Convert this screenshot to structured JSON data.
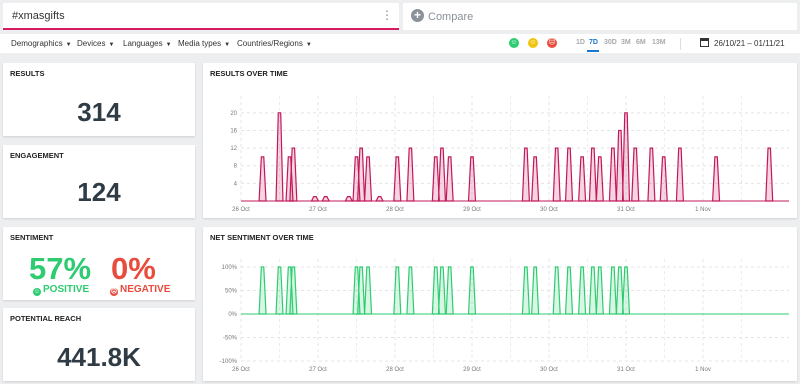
{
  "search": {
    "query": "#xmasgifts"
  },
  "compare": {
    "label": "Compare"
  },
  "filters": [
    "Demographics",
    "Devices",
    "Languages",
    "Media types",
    "Countries/Regions"
  ],
  "sentiment_filter_icons": [
    {
      "name": "positive-face-icon",
      "color": "#2ecc71",
      "glyph": "☺"
    },
    {
      "name": "neutral-face-icon",
      "color": "#f1c40f",
      "glyph": "☺"
    },
    {
      "name": "negative-face-icon",
      "color": "#e74c3c",
      "glyph": "☹"
    }
  ],
  "time_ranges": [
    "1D",
    "7D",
    "30D",
    "3M",
    "6M",
    "13M"
  ],
  "active_range": "7D",
  "date_range": "26/10/21 – 01/11/21",
  "results": {
    "title": "RESULTS",
    "value": "314"
  },
  "engagement": {
    "title": "ENGAGEMENT",
    "value": "124"
  },
  "sentiment": {
    "title": "SENTIMENT",
    "positive_pct": "57%",
    "positive_label": "POSITIVE",
    "negative_pct": "0%",
    "negative_label": "NEGATIVE",
    "positive_color": "#2ecc71",
    "negative_color": "#e74c3c"
  },
  "reach": {
    "title": "POTENTIAL REACH",
    "value": "441.8K"
  },
  "results_over_time": {
    "title": "RESULTS OVER TIME"
  },
  "net_sentiment": {
    "title": "NET SENTIMENT OVER TIME"
  },
  "chart_data": [
    {
      "type": "area",
      "title": "RESULTS OVER TIME",
      "color": "#c2185b",
      "x_ticks": [
        "26 Oct",
        "27 Oct",
        "28 Oct",
        "29 Oct",
        "30 Oct",
        "31 Oct",
        "1 Nov"
      ],
      "y_ticks": [
        4,
        8,
        12,
        16,
        20
      ],
      "ylim": [
        0,
        22
      ],
      "grid": true,
      "x_unit": "day offset from 26 Oct",
      "series": [
        {
          "values": [
            [
              0.28,
              10
            ],
            [
              0.5,
              20
            ],
            [
              0.63,
              10
            ],
            [
              0.68,
              12
            ],
            [
              0.96,
              1
            ],
            [
              1.1,
              1
            ],
            [
              1.4,
              1
            ],
            [
              1.5,
              10
            ],
            [
              1.56,
              12
            ],
            [
              1.65,
              10
            ],
            [
              1.8,
              1
            ],
            [
              2.03,
              10
            ],
            [
              2.2,
              12
            ],
            [
              2.53,
              10
            ],
            [
              2.61,
              12
            ],
            [
              2.71,
              10
            ],
            [
              3.0,
              10
            ],
            [
              3.7,
              12
            ],
            [
              3.82,
              10
            ],
            [
              4.1,
              12
            ],
            [
              4.26,
              12
            ],
            [
              4.43,
              10
            ],
            [
              4.57,
              12
            ],
            [
              4.66,
              10
            ],
            [
              4.83,
              12
            ],
            [
              4.92,
              16
            ],
            [
              5.0,
              20
            ],
            [
              5.12,
              12
            ],
            [
              5.33,
              12
            ],
            [
              5.49,
              10
            ],
            [
              5.7,
              12
            ],
            [
              6.17,
              10
            ],
            [
              6.86,
              12
            ]
          ]
        }
      ]
    },
    {
      "type": "area",
      "title": "NET SENTIMENT OVER TIME",
      "color": "#2ecc71",
      "x_ticks": [
        "26 Oct",
        "27 Oct",
        "28 Oct",
        "29 Oct",
        "30 Oct",
        "31 Oct",
        "1 Nov"
      ],
      "y_ticks": [
        "100%",
        "50%",
        "0%",
        "-50%",
        "-100%"
      ],
      "ylim": [
        -100,
        100
      ],
      "grid": true,
      "x_unit": "day offset from 26 Oct",
      "series": [
        {
          "values": [
            [
              0.28,
              100
            ],
            [
              0.5,
              100
            ],
            [
              0.63,
              100
            ],
            [
              0.68,
              100
            ],
            [
              1.5,
              100
            ],
            [
              1.56,
              100
            ],
            [
              1.65,
              100
            ],
            [
              2.03,
              100
            ],
            [
              2.2,
              100
            ],
            [
              2.53,
              100
            ],
            [
              2.61,
              100
            ],
            [
              2.71,
              100
            ],
            [
              3.0,
              100
            ],
            [
              3.7,
              100
            ],
            [
              3.82,
              100
            ],
            [
              4.1,
              100
            ],
            [
              4.26,
              100
            ],
            [
              4.43,
              100
            ],
            [
              4.57,
              100
            ],
            [
              4.66,
              100
            ],
            [
              4.83,
              100
            ],
            [
              4.92,
              100
            ],
            [
              5.0,
              100
            ]
          ]
        }
      ]
    }
  ]
}
